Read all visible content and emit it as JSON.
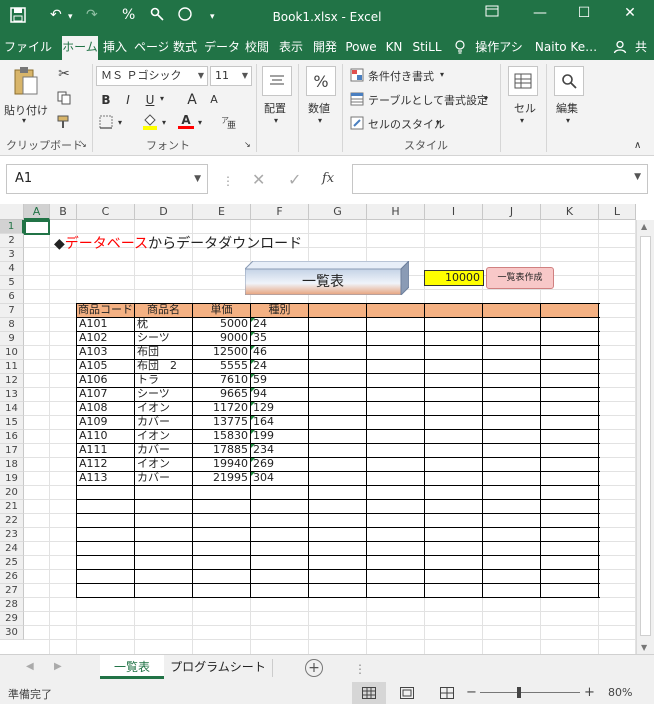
{
  "title_bar": {
    "title": "Book1.xlsx - Excel",
    "undo_icon": "undo-icon",
    "percent_symbol": "%",
    "minimize": "—",
    "maximize": "☐",
    "close": "✕"
  },
  "tabs": [
    {
      "label": "ファイル",
      "active": false
    },
    {
      "label": "ホーム",
      "active": true
    },
    {
      "label": "挿入",
      "active": false
    },
    {
      "label": "ページ",
      "active": false
    },
    {
      "label": "数式",
      "active": false
    },
    {
      "label": "データ",
      "active": false
    },
    {
      "label": "校閲",
      "active": false
    },
    {
      "label": "表示",
      "active": false
    },
    {
      "label": "開発",
      "active": false
    },
    {
      "label": "Powe",
      "active": false
    },
    {
      "label": "KN",
      "active": false
    },
    {
      "label": "StiLL",
      "active": false
    },
    {
      "label": "操作アシ",
      "active": false
    },
    {
      "label": "Naito Ke…",
      "active": false
    },
    {
      "label": "共",
      "active": false
    }
  ],
  "ribbon": {
    "clipboard": {
      "paste": "貼り付け",
      "label": "クリップボード"
    },
    "font": {
      "name": "ＭＳ Ｐゴシック",
      "size": "11",
      "bold": "B",
      "italic": "I",
      "underline": "U",
      "grow": "A",
      "shrink": "A",
      "font_color_letter": "A",
      "label": "フォント"
    },
    "alignment": {
      "label": "配置"
    },
    "number": {
      "label": "数値",
      "symbol": "%"
    },
    "styles": {
      "conditional": "条件付き書式",
      "table": "テーブルとして書式設定",
      "cell_style": "セルのスタイル",
      "label": "スタイル"
    },
    "cells": {
      "label": "セル"
    },
    "editing": {
      "label": "編集"
    }
  },
  "formula_bar": {
    "name_box": "A1",
    "fx": "fx",
    "value": ""
  },
  "sheet": {
    "columns": [
      "A",
      "B",
      "C",
      "D",
      "E",
      "F",
      "G",
      "H",
      "I",
      "J",
      "K",
      "L"
    ],
    "rows": [
      "1",
      "2",
      "3",
      "4",
      "5",
      "6",
      "7",
      "8",
      "9",
      "10",
      "11",
      "12",
      "13",
      "14",
      "15",
      "16",
      "17",
      "18",
      "19",
      "20",
      "21",
      "22",
      "23",
      "24",
      "25",
      "26",
      "27",
      "28",
      "29",
      "30"
    ],
    "heading": {
      "bullet": "◆",
      "part1": "データベース",
      "part2": "からデータダウンロード"
    },
    "list_button": "一覧表",
    "input_value": "10000",
    "create_button": "一覧表作成",
    "table": {
      "headers": [
        "商品コード",
        "商品名",
        "単価",
        "種別"
      ],
      "rows": [
        [
          "A101",
          "枕",
          "5000",
          "24"
        ],
        [
          "A102",
          "シーツ",
          "9000",
          "35"
        ],
        [
          "A103",
          "布団",
          "12500",
          "46"
        ],
        [
          "A105",
          "布団　2",
          "5555",
          "24"
        ],
        [
          "A106",
          "トラ",
          "7610",
          "59"
        ],
        [
          "A107",
          "シーツ",
          "9665",
          "94"
        ],
        [
          "A108",
          "イオン",
          "11720",
          "129"
        ],
        [
          "A109",
          "カバー",
          "13775",
          "164"
        ],
        [
          "A110",
          "イオン",
          "15830",
          "199"
        ],
        [
          "A111",
          "カバー",
          "17885",
          "234"
        ],
        [
          "A112",
          "イオン",
          "19940",
          "269"
        ],
        [
          "A113",
          "カバー",
          "21995",
          "304"
        ]
      ]
    }
  },
  "sheet_tabs": {
    "tabs": [
      {
        "label": "一覧表",
        "active": true
      },
      {
        "label": "プログラムシート",
        "active": false
      }
    ],
    "add": "+"
  },
  "status_bar": {
    "ready": "準備完了",
    "zoom": "80%",
    "minus": "−",
    "plus": "+"
  },
  "colors": {
    "excel_green": "#217346",
    "table_header_bg": "#f4b183",
    "input_yellow": "#ffff00",
    "create_button_bg": "#f8c8c8",
    "heading_red": "#ff0000"
  }
}
